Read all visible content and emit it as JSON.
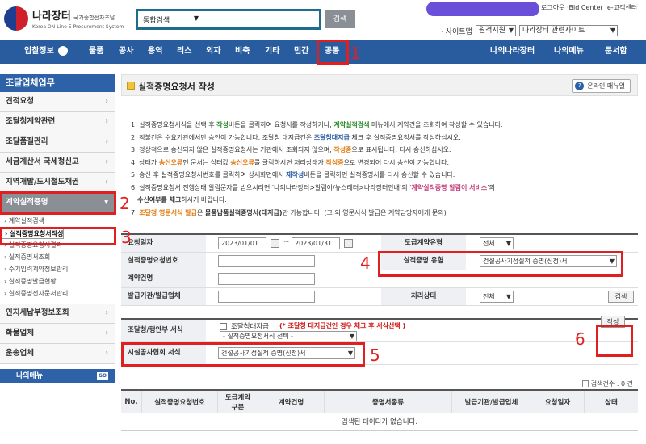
{
  "header": {
    "logo_main": "나라장터",
    "logo_sub": "국가종합전자조달",
    "logo_en": "Korea ON-Line E-Procurement System",
    "search_scope": "통합검색",
    "search_query": "",
    "search_button": "검색",
    "util_links": "로그아웃 ·Bid Center ·e-고객센터",
    "sitemap": "· 사이트맵",
    "remote_support": "원격지원",
    "related_sites": "나라장터 관련사이트"
  },
  "nav": {
    "bid_info": "입찰정보",
    "items": [
      "물품",
      "공사",
      "용역",
      "리스",
      "외자",
      "비축",
      "기타",
      "민간",
      "공동"
    ],
    "my_nara": "나의나라장터",
    "my_menu": "나의메뉴",
    "document_box": "문서함"
  },
  "sidebar": {
    "heading": "조달업체업무",
    "items": [
      {
        "label": "견적요청"
      },
      {
        "label": "조달청계약관련"
      },
      {
        "label": "조달품질관리"
      },
      {
        "label": "세금계산서 국세청신고"
      },
      {
        "label": "지역개발/도시철도채권"
      },
      {
        "label": "계약실적증명"
      }
    ],
    "subitems": [
      "› 계약실적검색",
      "› 실적증명요청서작성",
      "› 실적증명요청서처리",
      "› 실적증명요청서결과",
      "› 실적증명서조회",
      "› 수기입력계약정보관리",
      "› 실적증명발급현황",
      "› 실적증명전자문서관리"
    ],
    "after": [
      "인지세납부정보조회",
      "화물업체",
      "운송업체"
    ],
    "my_menu": "나의메뉴",
    "go": "GO"
  },
  "main": {
    "title": "실적증명요청서 작성",
    "manual_button": "온라인 매뉴얼",
    "notes": {
      "n1a": "1. 실적증명요청서식을 선택 후 ",
      "n1b": "작성",
      "n1c": "버튼을 클릭하여 요청서를 작성하거나, ",
      "n1d": "계약실적검색",
      "n1e": " 메뉴에서 계약건을 조회하여 작성할 수 있습니다.",
      "n2a": "2. 직불건은 수요기관에서만 승인이 가능합니다. 조달청 대지급건은 ",
      "n2b": "조달청대지급",
      "n2c": " 체크 후 실적증명요청서를 작성하십시오.",
      "n3a": "3. 정상적으로 송신되지 않은 실적증명요청서는 기관에서 조회되지 않으며, ",
      "n3b": "작성중",
      "n3c": "으로 표시됩니다. 다시 송신하십시오.",
      "n4a": "4. 상태가 ",
      "n4b": "송신오류",
      "n4c": "인 문서는 상태값 ",
      "n4d": "송신오류",
      "n4e": "를 클릭하시면 처리상태가 ",
      "n4f": "작성중",
      "n4g": "으로 변경되어 다시 송신이 가능합니다.",
      "n5a": "5. 송신 후 실적증명요청서번호를 클릭하여 상세화면에서 ",
      "n5b": "재작성",
      "n5c": "버튼을 클릭하면 실적증명서를 다시 송신할 수 있습니다.",
      "n6a": "6. 실적증명요청서 진행상태 알림문자를 받으시려면 '나의나라장터>알림이/뉴스레터>나라장터안내'의 '",
      "n6b": "계약실적증명 알림이 서비스",
      "n6c": "'의",
      "n6d": "수신여부를 체크",
      "n6e": "하시기 바랍니다.",
      "n7a": "7. ",
      "n7b": "조달청 영문서식 발급",
      "n7c": "은 ",
      "n7d": "물품납품실적증명서(대지급)",
      "n7e": "만 가능합니다. (그 외 영문서식 발급은 계약담당자에게 문의)"
    },
    "form": {
      "request_date_label": "요청일자",
      "date_from": "2023/01/01",
      "date_sep": "~",
      "date_to": "2023/01/31",
      "contract_type_label": "도급계약유형",
      "contract_type_value": "전체",
      "request_no_label": "실적증명요청번호",
      "cert_type_label": "실적증명 유형",
      "cert_type_value": "건설공사기성실적 증명(신청)서",
      "contract_name_label": "계약건명",
      "issuer_label": "발급기관/발급업체",
      "status_label": "처리상태",
      "status_value": "전체",
      "search_button": "검색"
    },
    "form2": {
      "pps_label": "조달청/행안부 서식",
      "pps_check": "조달청대지급",
      "pps_note": "(* 조달청 대지급건인 경우 체크 후 서식선택 )",
      "pps_select": "- 실적증명요청서식 선택 -",
      "assoc_label": "시설공사협회 서식",
      "assoc_select": "건설공사기성실적 증명(신청)서",
      "write_button": "작성"
    },
    "result_count": "검색건수 : 0 건",
    "table": {
      "headers": [
        "No.",
        "실적증명요청번호",
        "도급계약\n구분",
        "계약건명",
        "증명서종류",
        "발급기관/발급업체",
        "요청일자",
        "상태"
      ],
      "empty": "검색된 데이타가 없습니다."
    }
  },
  "annotations": [
    "1",
    "2",
    "3",
    "4",
    "5",
    "6"
  ],
  "colors": {
    "nav": "#285c9e",
    "annotation": "#e02020",
    "active_menu": "#8a8f96"
  }
}
